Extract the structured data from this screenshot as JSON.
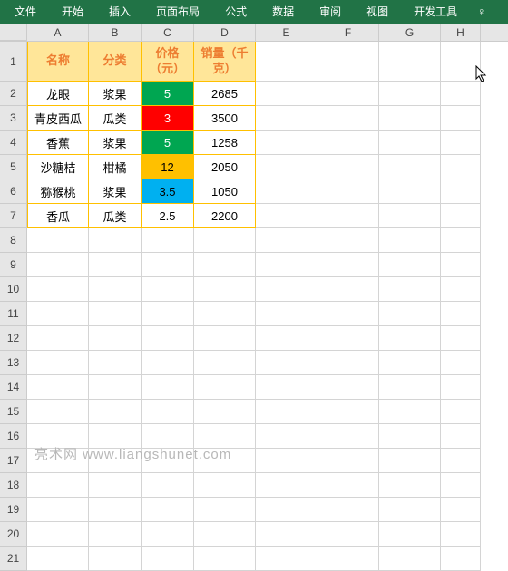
{
  "ribbon": {
    "tabs": [
      "文件",
      "开始",
      "插入",
      "页面布局",
      "公式",
      "数据",
      "审阅",
      "视图",
      "开发工具"
    ]
  },
  "columns": [
    "A",
    "B",
    "C",
    "D",
    "E",
    "F",
    "G",
    "H"
  ],
  "headers": {
    "name": "名称",
    "cat": "分类",
    "price": "价格（元）",
    "sales": "销量（千克）"
  },
  "rows": [
    {
      "n": "龙眼",
      "c": "浆果",
      "p": "5",
      "s": "2685",
      "pc": "price-green"
    },
    {
      "n": "青皮西瓜",
      "c": "瓜类",
      "p": "3",
      "s": "3500",
      "pc": "price-red"
    },
    {
      "n": "香蕉",
      "c": "浆果",
      "p": "5",
      "s": "1258",
      "pc": "price-green"
    },
    {
      "n": "沙糖桔",
      "c": "柑橘",
      "p": "12",
      "s": "2050",
      "pc": "price-orange"
    },
    {
      "n": "猕猴桃",
      "c": "浆果",
      "p": "3.5",
      "s": "1050",
      "pc": "price-blue"
    },
    {
      "n": "香瓜",
      "c": "瓜类",
      "p": "2.5",
      "s": "2200",
      "pc": ""
    }
  ],
  "chart_data": {
    "type": "table",
    "title": "",
    "columns": [
      "名称",
      "分类",
      "价格（元）",
      "销量（千克）"
    ],
    "data": [
      [
        "龙眼",
        "浆果",
        5,
        2685
      ],
      [
        "青皮西瓜",
        "瓜类",
        3,
        3500
      ],
      [
        "香蕉",
        "浆果",
        5,
        1258
      ],
      [
        "沙糖桔",
        "柑橘",
        12,
        2050
      ],
      [
        "猕猴桃",
        "浆果",
        3.5,
        1050
      ],
      [
        "香瓜",
        "瓜类",
        2.5,
        2200
      ]
    ]
  },
  "watermark": "亮术网 www.liangshunet.com",
  "emptyRows": 14
}
